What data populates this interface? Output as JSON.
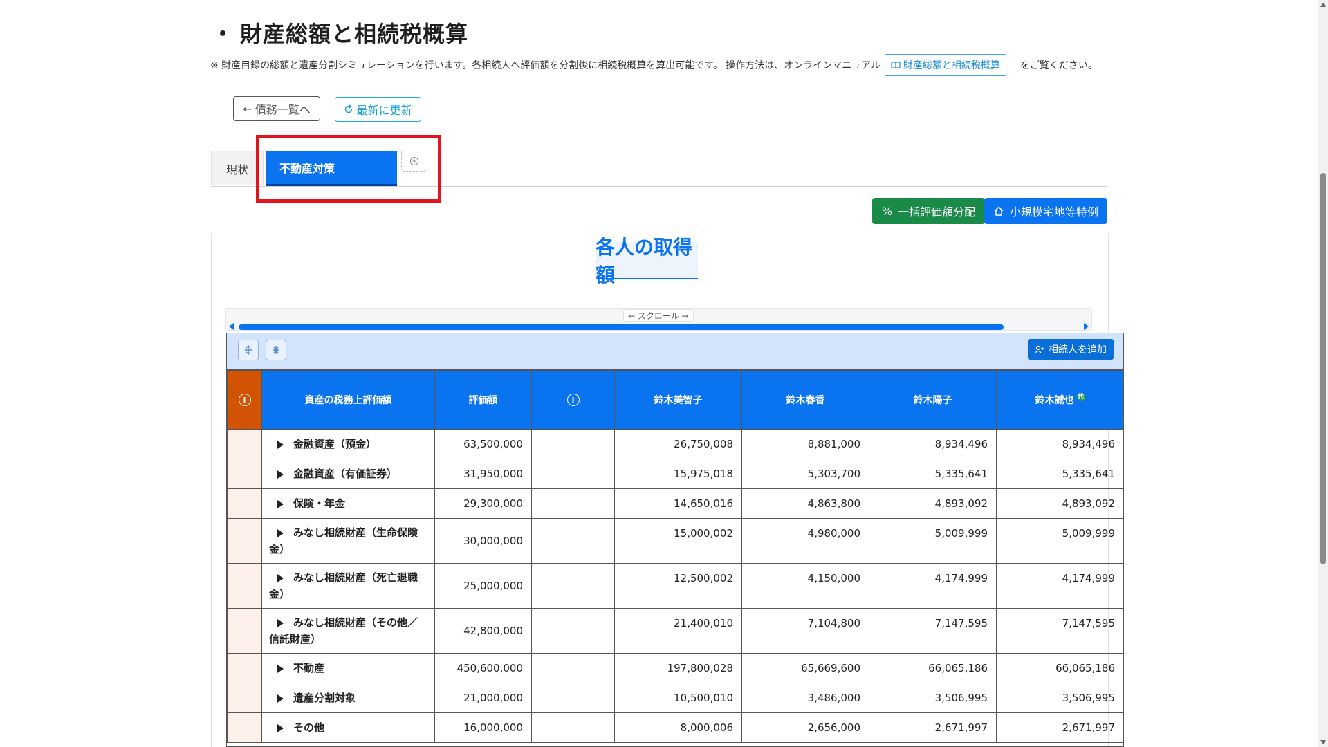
{
  "page": {
    "bullet": "・",
    "title": "財産総額と相続税概算",
    "description_prefix": "※ 財産目録の総額と遺産分割シミュレーションを行います。各相続人へ評価額を分割後に相続税概算を算出可能です。 操作方法は、オンラインマニュアル",
    "manual_link": "財産総額と相続税概算",
    "description_suffix": "をご覧ください。"
  },
  "actions": {
    "back_label": "債務一覧へ",
    "refresh_label": "最新に更新"
  },
  "tabs": {
    "current": "現状",
    "active": "不動産対策",
    "add_icon": "plus-circle-icon"
  },
  "toolbar": {
    "bulk_label": "一括評価額分配",
    "small_land_label": "小規模宅地等特例",
    "add_heir_label": "相続人を追加"
  },
  "section": {
    "title": "各人の取得額",
    "scroll_label": "← スクロール →"
  },
  "table": {
    "headers": {
      "asset": "資産の税務上評価額",
      "value": "評価額",
      "heirs": [
        "鈴木美智子",
        "鈴木春香",
        "鈴木陽子",
        "鈴木誠也"
      ],
      "heir_badge": "代"
    },
    "rows": [
      {
        "name": "金融資産（預金）",
        "value": "63,500,000",
        "h": [
          "26,750,008",
          "8,881,000",
          "8,934,496",
          "8,934,496"
        ]
      },
      {
        "name": "金融資産（有価証券）",
        "value": "31,950,000",
        "h": [
          "15,975,018",
          "5,303,700",
          "5,335,641",
          "5,335,641"
        ]
      },
      {
        "name": "保険・年金",
        "value": "29,300,000",
        "h": [
          "14,650,016",
          "4,863,800",
          "4,893,092",
          "4,893,092"
        ]
      },
      {
        "name": "みなし相続財産（生命保険金）",
        "value": "30,000,000",
        "h": [
          "15,000,002",
          "4,980,000",
          "5,009,999",
          "5,009,999"
        ]
      },
      {
        "name": "みなし相続財産（死亡退職金）",
        "value": "25,000,000",
        "h": [
          "12,500,002",
          "4,150,000",
          "4,174,999",
          "4,174,999"
        ]
      },
      {
        "name": "みなし相続財産（その他／信託財産）",
        "value": "42,800,000",
        "h": [
          "21,400,010",
          "7,104,800",
          "7,147,595",
          "7,147,595"
        ]
      },
      {
        "name": "不動産",
        "value": "450,600,000",
        "h": [
          "197,800,028",
          "65,669,600",
          "66,065,186",
          "66,065,186"
        ]
      },
      {
        "name": "遺産分割対象",
        "value": "21,000,000",
        "h": [
          "10,500,010",
          "3,486,000",
          "3,506,995",
          "3,506,995"
        ]
      },
      {
        "name": "その他",
        "value": "16,000,000",
        "h": [
          "8,000,006",
          "2,656,000",
          "2,671,997",
          "2,671,997"
        ]
      }
    ]
  },
  "colors": {
    "primary": "#0a73ef",
    "green": "#1a8a49",
    "orange_header": "#d25304",
    "highlight_red": "#e0151e"
  }
}
